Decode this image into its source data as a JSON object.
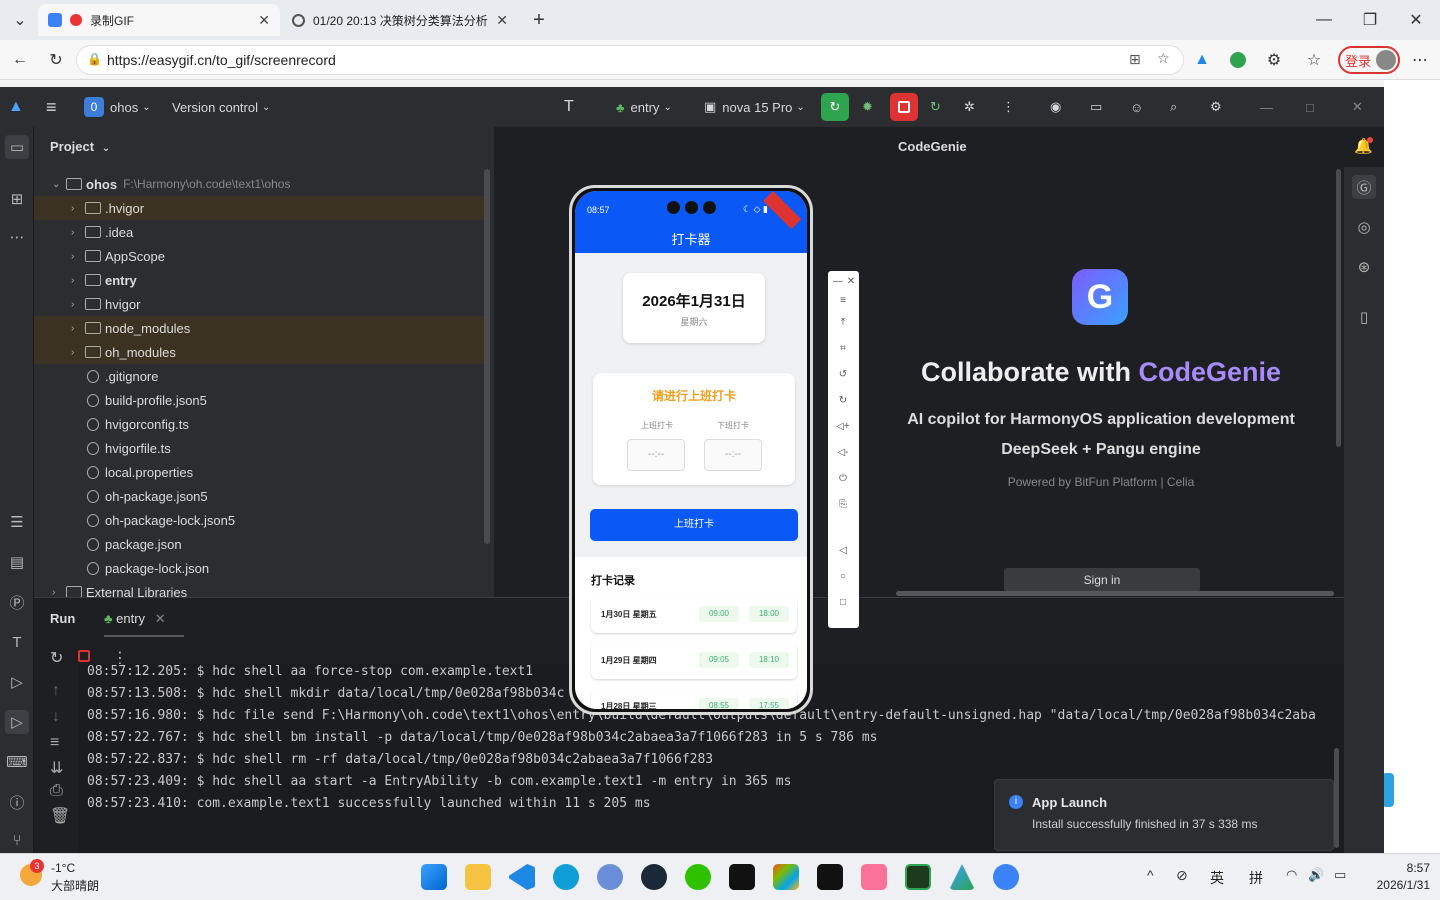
{
  "browser": {
    "tabs": [
      {
        "title": "录制GIF",
        "active": true
      },
      {
        "title": "01/20 20:13 决策树分类算法分析",
        "active": false
      }
    ],
    "url": "https://easygif.cn/to_gif/screenrecord",
    "login_label": "登录"
  },
  "ide": {
    "project_badge": "0",
    "project_name": "ohos",
    "version_control": "Version control",
    "run_config": "entry",
    "device": "nova 15 Pro",
    "panel_title": "Project",
    "tree": [
      {
        "name": "ohos",
        "path": "F:\\Harmony\\oh.code\\text1\\ohos",
        "bold": true,
        "depth": 0,
        "expand": "open",
        "hl": false
      },
      {
        "name": ".hvigor",
        "depth": 1,
        "expand": "closed",
        "hl": true
      },
      {
        "name": ".idea",
        "depth": 1,
        "expand": "closed",
        "hl": false
      },
      {
        "name": "AppScope",
        "depth": 1,
        "expand": "closed",
        "hl": false
      },
      {
        "name": "entry",
        "depth": 1,
        "expand": "closed",
        "bold": true,
        "hl": false
      },
      {
        "name": "hvigor",
        "depth": 1,
        "expand": "closed",
        "hl": false
      },
      {
        "name": "node_modules",
        "depth": 1,
        "expand": "closed",
        "hl": true
      },
      {
        "name": "oh_modules",
        "depth": 1,
        "expand": "closed",
        "hl": true
      },
      {
        "name": ".gitignore",
        "depth": 1,
        "expand": "none",
        "hl": false
      },
      {
        "name": "build-profile.json5",
        "depth": 1,
        "expand": "none",
        "hl": false
      },
      {
        "name": "hvigorconfig.ts",
        "depth": 1,
        "expand": "none",
        "hl": false
      },
      {
        "name": "hvigorfile.ts",
        "depth": 1,
        "expand": "none",
        "hl": false
      },
      {
        "name": "local.properties",
        "depth": 1,
        "expand": "none",
        "hl": false
      },
      {
        "name": "oh-package.json5",
        "depth": 1,
        "expand": "none",
        "hl": false
      },
      {
        "name": "oh-package-lock.json5",
        "depth": 1,
        "expand": "none",
        "hl": false
      },
      {
        "name": "package.json",
        "depth": 1,
        "expand": "none",
        "hl": false
      },
      {
        "name": "package-lock.json",
        "depth": 1,
        "expand": "none",
        "hl": false
      },
      {
        "name": "External Libraries",
        "depth": 0,
        "expand": "closed",
        "hl": false
      }
    ],
    "run_tab": "Run",
    "run_entry": "entry",
    "log": [
      "08:57:12.205: $ hdc shell aa force-stop com.example.text1",
      "08:57:13.508: $ hdc shell mkdir data/local/tmp/0e028af98b034c",
      "08:57:16.980: $ hdc file send F:\\Harmony\\oh.code\\text1\\ohos\\entry\\build\\default\\outputs\\default\\entry-default-unsigned.hap \"data/local/tmp/0e028af98b034c2aba",
      "08:57:22.767: $ hdc shell bm install -p data/local/tmp/0e028af98b034c2abaea3a7f1066f283 in 5 s 786 ms",
      "08:57:22.837: $ hdc shell rm -rf data/local/tmp/0e028af98b034c2abaea3a7f1066f283",
      "08:57:23.409: $ hdc shell aa start -a EntryAbility -b com.example.text1 -m entry in 365 ms",
      "08:57:23.410: com.example.text1 successfully launched within 11 s 205 ms"
    ],
    "genie": {
      "title": "CodeGenie",
      "headline_prefix": "Collaborate with ",
      "headline_brand": "CodeGenie",
      "line1": "AI copilot for HarmonyOS application development",
      "line2": "DeepSeek + Pangu engine",
      "powered": "Powered by BitFun Platform | Celia",
      "signin": "Sign in"
    },
    "toast": {
      "title": "App Launch",
      "body": "Install successfully finished in 37 s 338 ms"
    }
  },
  "phone": {
    "time": "08:57",
    "app_title": "打卡器",
    "date": "2026年1月31日",
    "weekday": "星期六",
    "prompt": "请进行上班打卡",
    "in_label": "上班打卡",
    "out_label": "下班打卡",
    "in_value": "--:--",
    "out_value": "--:--",
    "button": "上班打卡",
    "records_title": "打卡记录",
    "records": [
      {
        "date": "1月30日 星期五",
        "in": "09:00",
        "out": "18:00"
      },
      {
        "date": "1月29日 星期四",
        "in": "09:05",
        "out": "18:10"
      },
      {
        "date": "1月28日 星期三",
        "in": "08:55",
        "out": "17:55"
      }
    ]
  },
  "taskbar": {
    "weather_badge": "3",
    "temp": "-1°C",
    "weather": "大部晴朗",
    "ime1": "英",
    "ime2": "拼",
    "time": "8:57",
    "date": "2026/1/31"
  },
  "colors": {
    "accent": "#0a59f7",
    "genie": "#a78bfa",
    "prompt": "#f0a020",
    "green": "#3cb371"
  }
}
